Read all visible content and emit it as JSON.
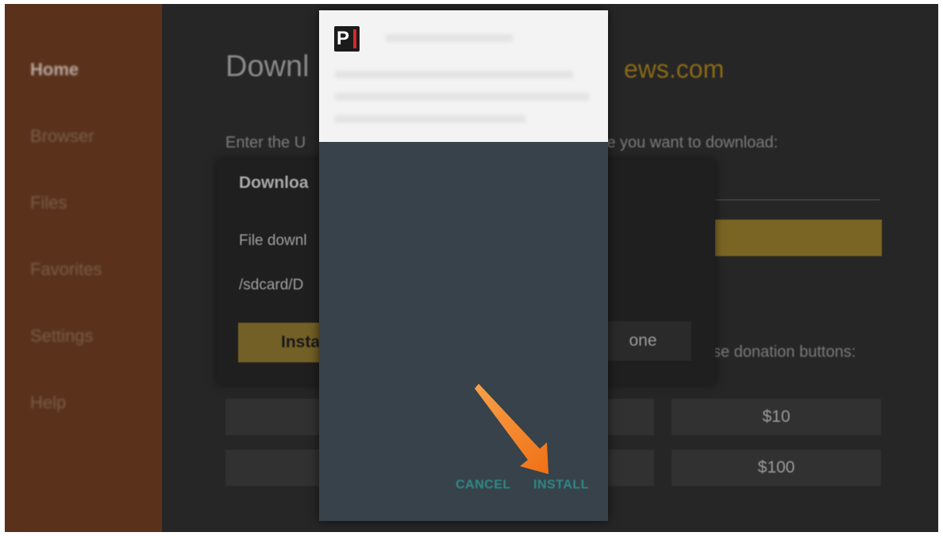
{
  "sidebar": {
    "items": [
      {
        "label": "Home",
        "active": true
      },
      {
        "label": "Browser",
        "active": false
      },
      {
        "label": "Files",
        "active": false
      },
      {
        "label": "Favorites",
        "active": false
      },
      {
        "label": "Settings",
        "active": false
      },
      {
        "label": "Help",
        "active": false
      }
    ]
  },
  "main": {
    "title_partial": "Downl",
    "title_domain_partial": "ews.com",
    "instruction_left": "Enter the U",
    "instruction_right": "r the file you want to download:",
    "donation_text_partial": "se donation buttons:",
    "donation_buttons": [
      "$10",
      "$100"
    ]
  },
  "download_dialog": {
    "title_partial": "Downloa",
    "message_partial": "File downl",
    "path_partial": "/sdcard/D",
    "install_label_partial": "Insta",
    "done_label_partial": "one"
  },
  "install_popup": {
    "cancel_label": "CANCEL",
    "install_label": "INSTALL"
  },
  "colors": {
    "sidebar": "#5a321b",
    "accent_gold": "#7a6524",
    "popup_body": "#37424a",
    "popup_button_text": "#2f8a87",
    "arrow": "#f57c1f"
  },
  "icons": {
    "app_icon": "app-icon",
    "annotation": "arrow-icon"
  }
}
